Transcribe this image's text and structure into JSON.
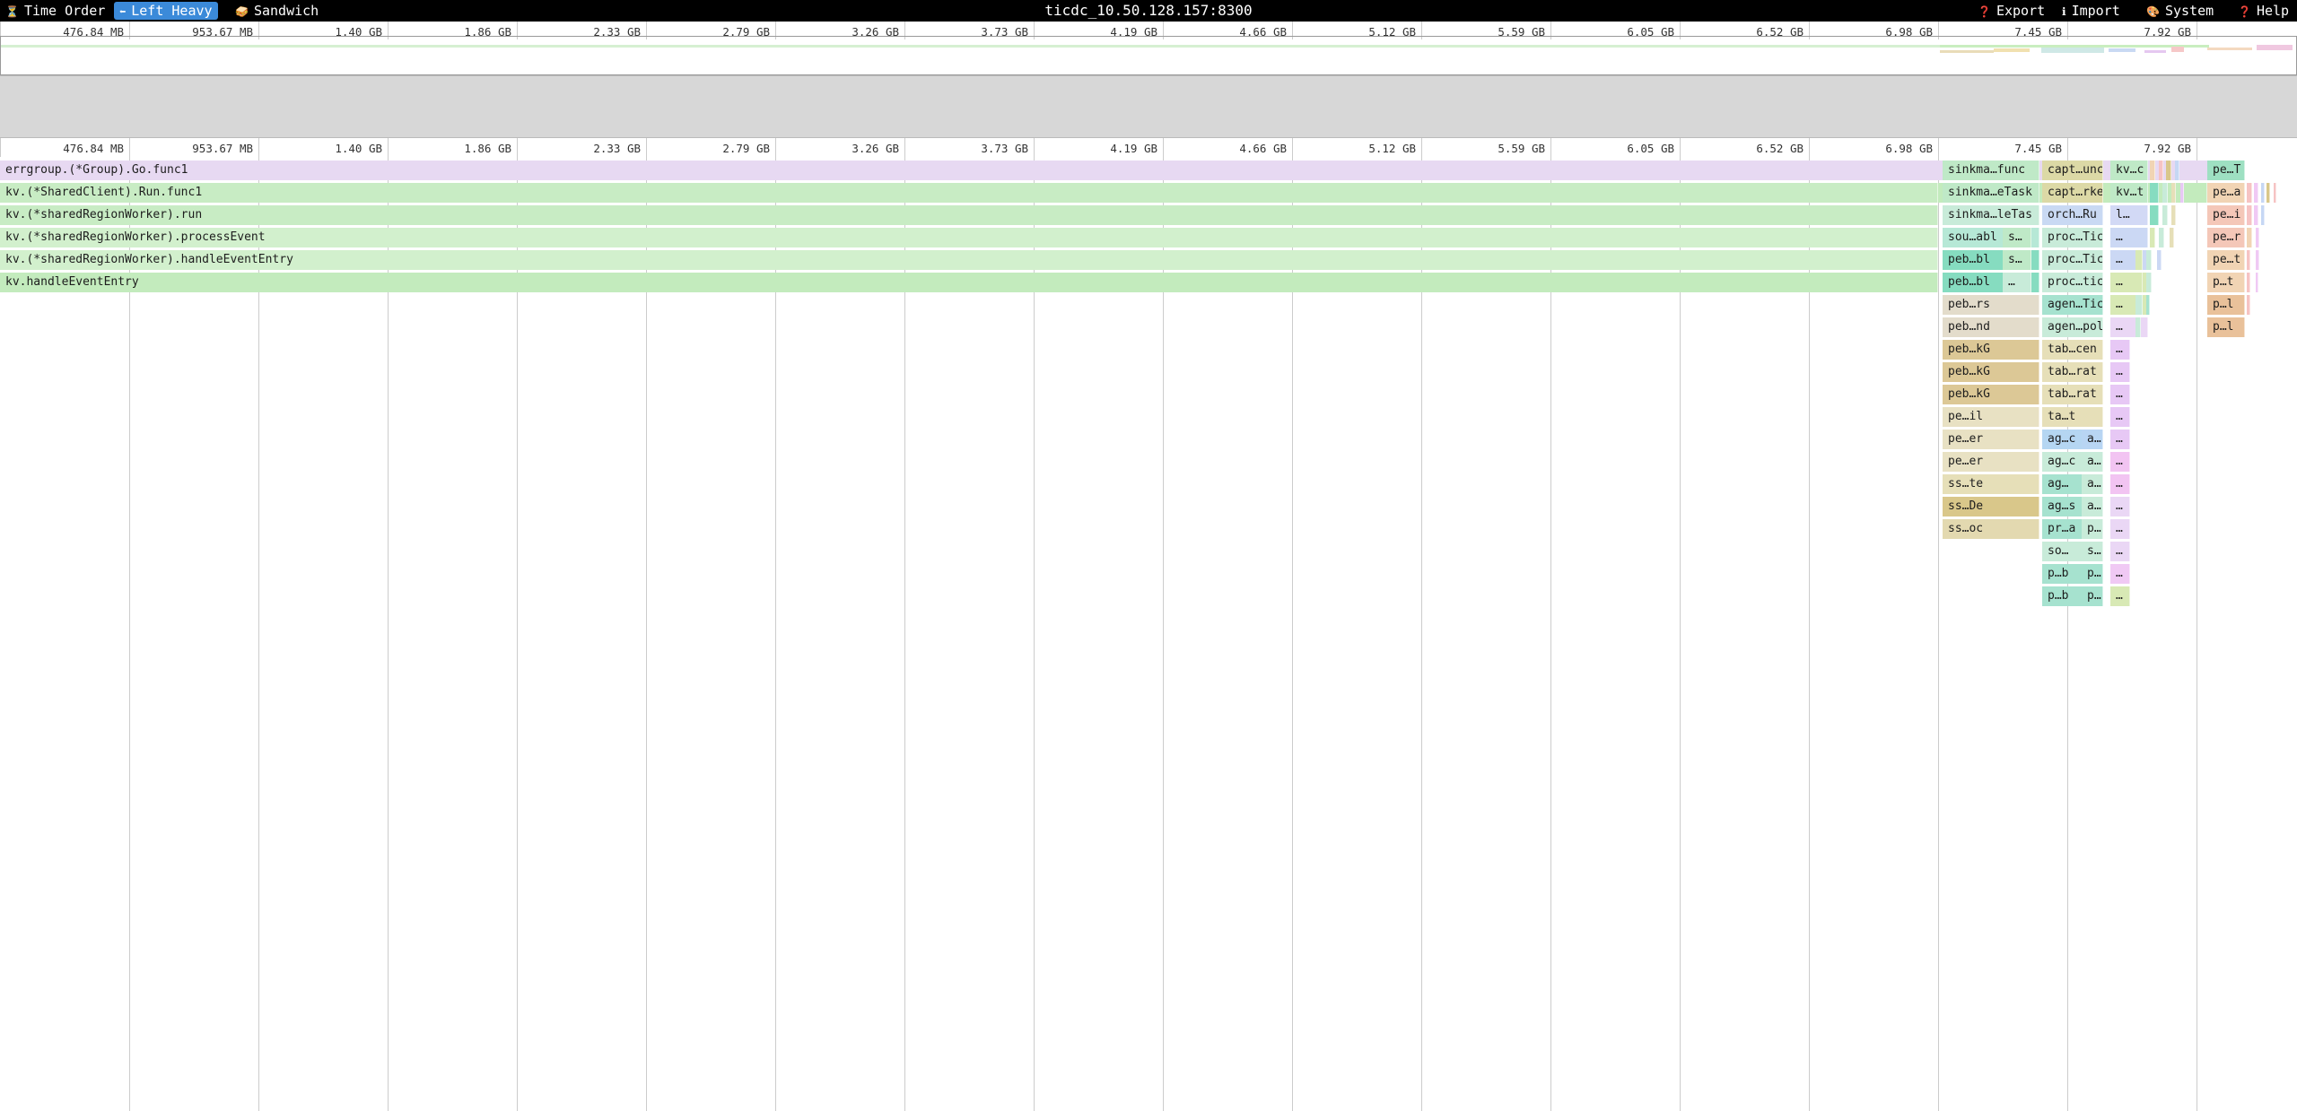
{
  "toolbar": {
    "tabs": [
      {
        "label": "Time Order",
        "icon": "hourglass-icon"
      },
      {
        "label": "Left Heavy",
        "icon": "left-arrow-icon"
      },
      {
        "label": "Sandwich",
        "icon": "sandwich-icon"
      }
    ],
    "title": "ticdc_10.50.128.157:8300",
    "actions": [
      {
        "label": "Export",
        "icon": "question-icon"
      },
      {
        "label": "Import",
        "icon": "info-icon"
      },
      {
        "label": "System",
        "icon": "palette-icon"
      },
      {
        "label": "Help",
        "icon": "help-icon"
      }
    ]
  },
  "ruler_ticks": [
    "476.84 MB",
    "953.67 MB",
    "1.40 GB",
    "1.86 GB",
    "2.33 GB",
    "2.79 GB",
    "3.26 GB",
    "3.73 GB",
    "4.19 GB",
    "4.66 GB",
    "5.12 GB",
    "5.59 GB",
    "6.05 GB",
    "6.52 GB",
    "6.98 GB",
    "7.45 GB",
    "7.92 GB"
  ],
  "flame_rows": [
    "errgroup.(*Group).Go.func1",
    "kv.(*SharedClient).Run.func1",
    "kv.(*sharedRegionWorker).run",
    "kv.(*sharedRegionWorker).processEvent",
    "kv.(*sharedRegionWorker).handleEventEntry",
    "kv.handleEventEntry"
  ],
  "right_frames": {
    "c1": [
      "sinkma…func",
      "sinkma…eTask",
      "sinkma…leTas",
      "sou…abl",
      "peb…bl",
      "peb…bl",
      "peb…rs",
      "peb…nd",
      "peb…kG",
      "peb…kG",
      "peb…kG",
      "pe…il",
      "pe…er",
      "pe…er",
      "ss…te",
      "ss…De",
      "ss…oc"
    ],
    "c2": [
      "s…",
      "s…",
      "…"
    ],
    "c3": [
      "capt…unc",
      "capt…rke",
      "orch…Ru",
      "proc…Tic",
      "proc…Tic",
      "proc…tic",
      "agen…Tic",
      "agen…pol",
      "tab…cen",
      "tab…rat",
      "tab…rat",
      "ta…t",
      "ag…c",
      "ag…c",
      "ag…",
      "ag…s",
      "pr…a",
      "so…",
      "p…b",
      "p…b"
    ],
    "c4": [
      "kv…c",
      "kv…t",
      "l…",
      "…",
      "…",
      "…",
      "…",
      "…"
    ],
    "c5": [
      "…",
      "…",
      "…",
      "…",
      "…",
      "…",
      "…",
      "…",
      "…",
      "…",
      "…",
      "…"
    ],
    "c6": [
      "a…",
      "a…",
      "a…",
      "a…",
      "p…",
      "s…",
      "p…",
      "p…"
    ],
    "c7": [
      "pe…T",
      "pe…a",
      "pe…i",
      "pe…r",
      "pe…t",
      "p…t",
      "p…l",
      "p…l"
    ]
  }
}
